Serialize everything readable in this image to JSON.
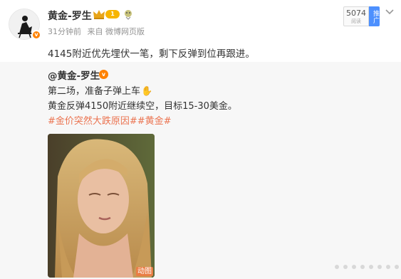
{
  "author": {
    "name": "黄金-罗生",
    "level": "1",
    "avatar_badge": "v"
  },
  "meta": {
    "time": "31分钟前",
    "source": "来自 微博网页版"
  },
  "stats": {
    "read_count": "5074",
    "read_label": "阅读",
    "promote_label": "推广"
  },
  "post_text": "4145附近优先埋伏一笔，剩下反弹到位再跟进。",
  "repost": {
    "author": "@黄金-罗生",
    "verified": "v",
    "line1": "第二场，准备子弹上车",
    "line2": "黄金反弹4150附近继续空，目标15-30美金。",
    "hashtags": "#金价突然大跌原因##黄金#",
    "gif_badge": "动图"
  },
  "icons": [
    "crown-icon",
    "sticker-icon",
    "chevron-down-icon",
    "verified-icon",
    "clap-icon"
  ],
  "colors": {
    "accent_orange": "#ff8200",
    "hashtag": "#eb7350",
    "promote": "#4d90fe",
    "repost_bg": "#f7f7f7"
  }
}
